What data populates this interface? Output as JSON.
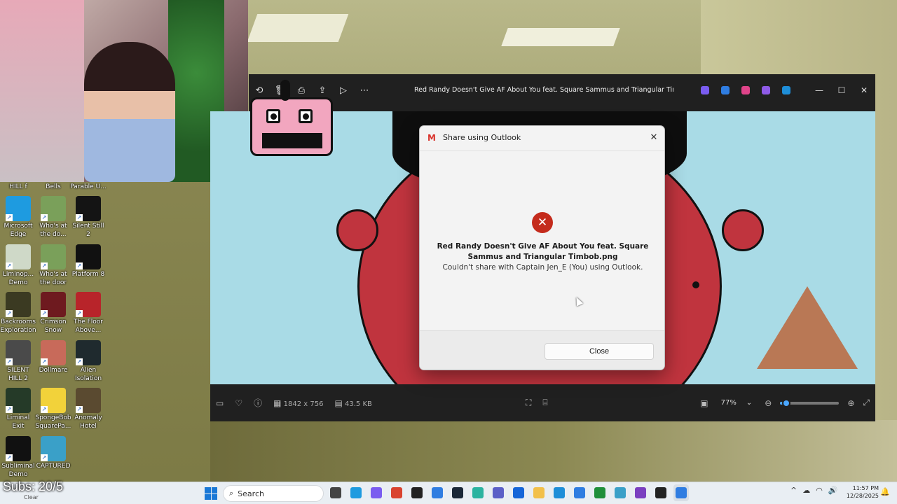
{
  "overlay": {
    "subs_text": "Subs: 20/5",
    "clear_text": "Clear"
  },
  "desktop": {
    "top_labels": [
      "HILL f",
      "Bells",
      "Parable U..."
    ],
    "icons": [
      {
        "label": "Microsoft Edge",
        "icon": "edge-icon",
        "color": "#1e9be0"
      },
      {
        "label": "Who's at the do...",
        "icon": "face-icon",
        "color": "#7aa05a"
      },
      {
        "label": "Silent Still 2",
        "icon": "dark-icon",
        "color": "#141414"
      },
      {
        "label": "Liminop... Demo",
        "icon": "game-icon",
        "color": "#cfd9c8"
      },
      {
        "label": "Who's at the door",
        "icon": "face-icon",
        "color": "#7aa05a"
      },
      {
        "label": "Platform 8",
        "icon": "eight-icon",
        "color": "#111111"
      },
      {
        "label": "Backrooms Exploration",
        "icon": "backrooms-icon",
        "color": "#3b3a22"
      },
      {
        "label": "Crimson Snow",
        "icon": "crimson-icon",
        "color": "#6e1a1f"
      },
      {
        "label": "The Floor Above...",
        "icon": "hydrant-icon",
        "color": "#b8242a"
      },
      {
        "label": "SILENT HILL 2",
        "icon": "silent-hill-icon",
        "color": "#4a4a4a"
      },
      {
        "label": "Dollmare",
        "icon": "doll-icon",
        "color": "#c86a5a"
      },
      {
        "label": "Alien Isolation",
        "icon": "alien-icon",
        "color": "#1f2a2e"
      },
      {
        "label": "Liminal Exit",
        "icon": "exit-icon",
        "color": "#253a28"
      },
      {
        "label": "SpongeBob SquarePa...",
        "icon": "spongebob-icon",
        "color": "#f2d23a"
      },
      {
        "label": "Anomaly Hotel",
        "icon": "hotel-icon",
        "color": "#5a4a30"
      },
      {
        "label": "Subliminal Demo",
        "icon": "subliminal-icon",
        "color": "#111111"
      },
      {
        "label": "CAPTURED",
        "icon": "hand-icon",
        "color": "#3aa0c8"
      }
    ]
  },
  "viewer": {
    "title": "Red Randy Doesn't Give AF About You feat. Square Sammus and Triangular Timbob.png",
    "toolbar": [
      "rotate-icon",
      "delete-icon",
      "print-icon",
      "share-icon",
      "slideshow-icon",
      "more-icon"
    ],
    "app_icons": [
      {
        "name": "copilot-icon",
        "color": "#7a5cf0"
      },
      {
        "name": "designer-icon",
        "color": "#2f7de1"
      },
      {
        "name": "paint-icon",
        "color": "#e0448a"
      },
      {
        "name": "clipchamp-icon",
        "color": "#8f5be8"
      },
      {
        "name": "onedrive-icon",
        "color": "#1e8ed8"
      }
    ],
    "image_size": "1842 x 756",
    "file_size": "43.5 KB",
    "zoom": "77%",
    "zoom_fraction": 0.1
  },
  "dialog": {
    "title": "Share using Outlook",
    "filename": "Red Randy Doesn't Give AF About You feat. Square Sammus and Triangular Timbob.png",
    "message": "Couldn't share with Captain Jen_E (You) using Outlook.",
    "close_label": "Close"
  },
  "taskbar": {
    "search_placeholder": "Search",
    "apps": [
      {
        "name": "file-manager-icon",
        "color": "#444444"
      },
      {
        "name": "edge-icon",
        "color": "#1e9be0"
      },
      {
        "name": "copilot-icon",
        "color": "#7a5cf0"
      },
      {
        "name": "chrome-icon",
        "color": "#d9432f"
      },
      {
        "name": "epic-icon",
        "color": "#222222"
      },
      {
        "name": "azure-icon",
        "color": "#2f7de1"
      },
      {
        "name": "steam-icon",
        "color": "#1b2838"
      },
      {
        "name": "snipping-icon",
        "color": "#2bb3a0"
      },
      {
        "name": "teams-icon",
        "color": "#5b5fc7"
      },
      {
        "name": "dropbox-icon",
        "color": "#1565d8"
      },
      {
        "name": "folder-icon",
        "color": "#f2c04a"
      },
      {
        "name": "mail-icon",
        "color": "#1e8ed8"
      },
      {
        "name": "store-icon",
        "color": "#2f7de1"
      },
      {
        "name": "xbox-icon",
        "color": "#1f8f3a"
      },
      {
        "name": "game-icon",
        "color": "#3aa0c8"
      },
      {
        "name": "vs-icon",
        "color": "#7a3fc0"
      },
      {
        "name": "obs-icon",
        "color": "#222222"
      },
      {
        "name": "photos-icon",
        "color": "#2f7de1"
      }
    ],
    "time": "11:57 PM",
    "date": "12/28/2025"
  }
}
